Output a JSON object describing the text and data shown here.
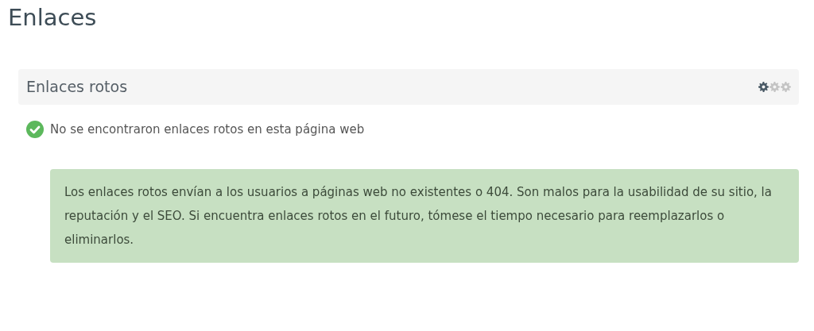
{
  "page_title": "Enlaces",
  "panel": {
    "title": "Enlaces rotos",
    "gears": [
      {
        "active": true
      },
      {
        "active": false
      },
      {
        "active": false
      }
    ]
  },
  "status": {
    "kind": "success",
    "text": "No se encontraron enlaces rotos en esta página web"
  },
  "info": "Los enlaces rotos envían a los usuarios a páginas web no existentes o 404. Son malos para la usabilidad de su sitio, la reputación y el SEO. Si encuentra enlaces rotos en el futuro, tómese el tiempo necesario para reemplazarlos o eliminarlos."
}
